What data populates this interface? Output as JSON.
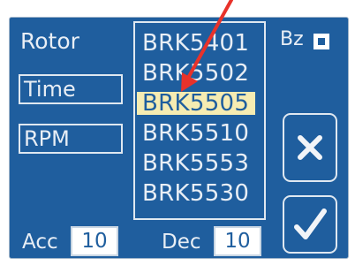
{
  "panel": {
    "rotor_label": "Rotor",
    "time_label": "Time",
    "rpm_label": "RPM",
    "bz_label": "Bz",
    "bz_checked": true,
    "acc_label": "Acc",
    "acc_value": "10",
    "dec_label": "Dec",
    "dec_value": "10"
  },
  "rotor_list": {
    "items": [
      "BRK5401",
      "BRK5502",
      "BRK5505",
      "BRK5510",
      "BRK5553",
      "BRK5530"
    ],
    "selected_index": 2
  },
  "buttons": {
    "cancel_icon": "x-icon",
    "confirm_icon": "checkmark-icon"
  },
  "colors": {
    "panel_bg": "#1f5e9e",
    "selection_bg": "#f6ecb2",
    "arrow": "#e8322a"
  }
}
